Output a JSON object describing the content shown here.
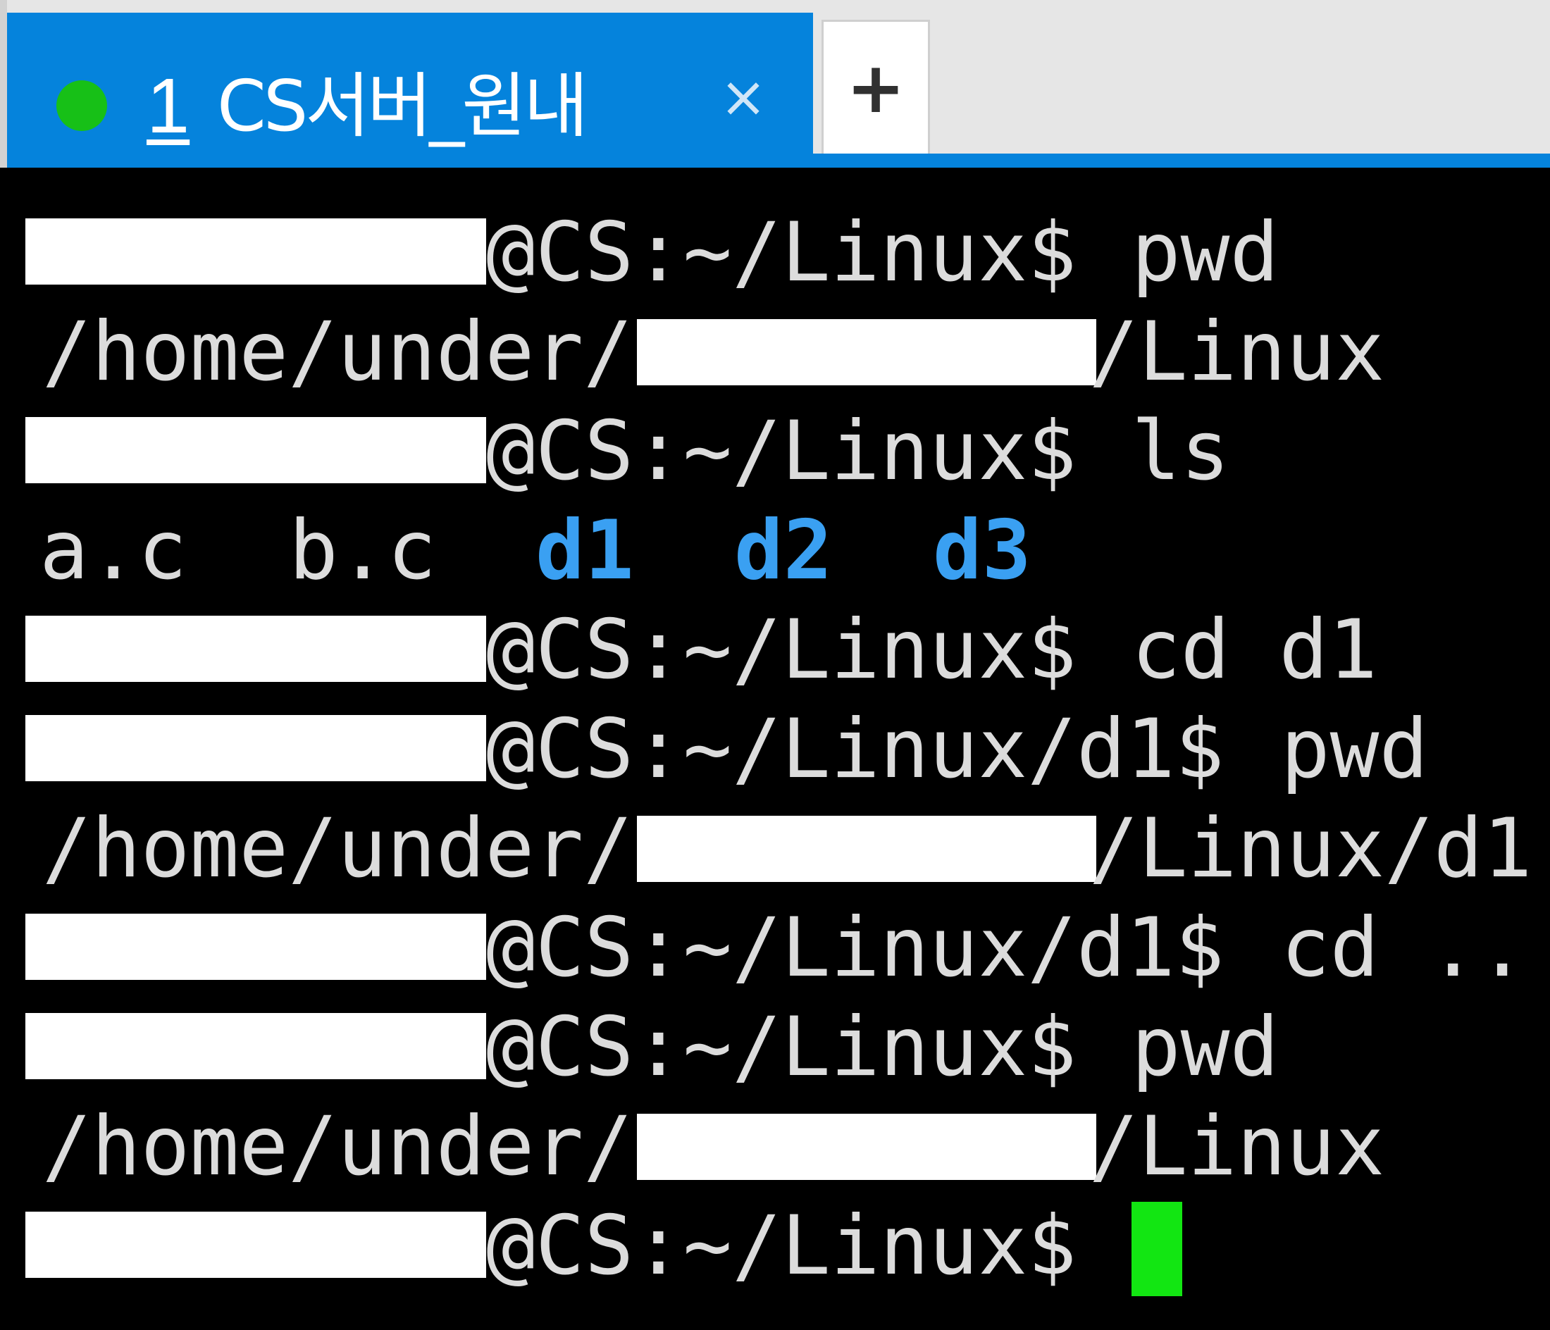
{
  "tabbar": {
    "tabs": [
      {
        "index": "1",
        "title": "CS서버_원내",
        "status": "connected",
        "close_glyph": "×"
      }
    ],
    "new_tab_glyph": "+"
  },
  "terminal": {
    "prompt_suffix_linux": "@CS:~/Linux$",
    "prompt_suffix_d1": "@CS:~/Linux/d1$",
    "path_prefix": "/home/under/",
    "lines": [
      {
        "type": "prompt",
        "prompt": "@CS:~/Linux$",
        "command": " pwd"
      },
      {
        "type": "path_output",
        "prefix": "/home/under/",
        "suffix": "/Linux"
      },
      {
        "type": "prompt",
        "prompt": "@CS:~/Linux$",
        "command": " ls"
      },
      {
        "type": "ls_output",
        "files": [
          "a.c",
          "b.c"
        ],
        "dirs": [
          "d1",
          "d2",
          "d3"
        ]
      },
      {
        "type": "prompt",
        "prompt": "@CS:~/Linux$",
        "command": " cd d1"
      },
      {
        "type": "prompt",
        "prompt": "@CS:~/Linux/d1$",
        "command": " pwd"
      },
      {
        "type": "path_output",
        "prefix": "/home/under/",
        "suffix": "/Linux/d1"
      },
      {
        "type": "prompt",
        "prompt": "@CS:~/Linux/d1$",
        "command": " cd .."
      },
      {
        "type": "prompt",
        "prompt": "@CS:~/Linux$",
        "command": " pwd"
      },
      {
        "type": "path_output",
        "prefix": "/home/under/",
        "suffix": "/Linux"
      },
      {
        "type": "prompt",
        "prompt": "@CS:~/Linux$",
        "command": " "
      }
    ]
  },
  "colors": {
    "tab_active": "#0583dc",
    "status_dot": "#17c017",
    "terminal_bg": "#000000",
    "terminal_fg": "#dcdcdc",
    "directory": "#3aa0f2",
    "cursor": "#12e612"
  }
}
